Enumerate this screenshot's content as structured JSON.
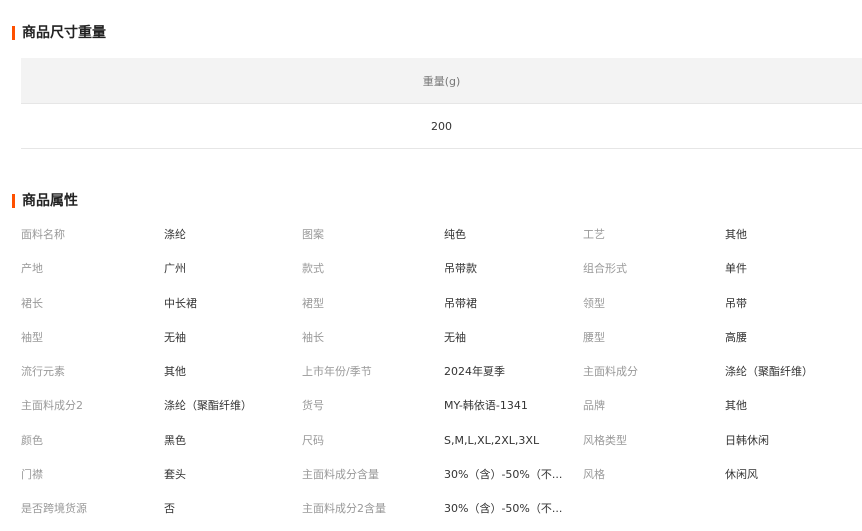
{
  "size_section": {
    "title": "商品尺寸重量",
    "header": "重量(g)",
    "value": "200"
  },
  "attr_section": {
    "title": "商品属性",
    "rows": [
      [
        [
          "面料名称",
          "涤纶"
        ],
        [
          "图案",
          "纯色"
        ],
        [
          "工艺",
          "其他"
        ]
      ],
      [
        [
          "产地",
          "广州"
        ],
        [
          "款式",
          "吊带款"
        ],
        [
          "组合形式",
          "单件"
        ]
      ],
      [
        [
          "裙长",
          "中长裙"
        ],
        [
          "裙型",
          "吊带裙"
        ],
        [
          "领型",
          "吊带"
        ]
      ],
      [
        [
          "袖型",
          "无袖"
        ],
        [
          "袖长",
          "无袖"
        ],
        [
          "腰型",
          "高腰"
        ]
      ],
      [
        [
          "流行元素",
          "其他"
        ],
        [
          "上市年份/季节",
          "2024年夏季"
        ],
        [
          "主面料成分",
          "涤纶（聚酯纤维）"
        ]
      ],
      [
        [
          "主面料成分2",
          "涤纶（聚酯纤维）"
        ],
        [
          "货号",
          "MY-韩依语-1341"
        ],
        [
          "品牌",
          "其他"
        ]
      ],
      [
        [
          "颜色",
          "黑色"
        ],
        [
          "尺码",
          "S,M,L,XL,2XL,3XL"
        ],
        [
          "风格类型",
          "日韩休闲"
        ]
      ],
      [
        [
          "门襟",
          "套头"
        ],
        [
          "主面料成分含量",
          "30%（含）-50%（不..."
        ],
        [
          "风格",
          "休闲风"
        ]
      ],
      [
        [
          "是否跨境货源",
          "否"
        ],
        [
          "主面料成分2含量",
          "30%（含）-50%（不..."
        ]
      ]
    ]
  },
  "colors": {
    "accent": "#ff5000",
    "header_bg": "#f3f3f3",
    "label": "#999999",
    "value": "#333333"
  }
}
